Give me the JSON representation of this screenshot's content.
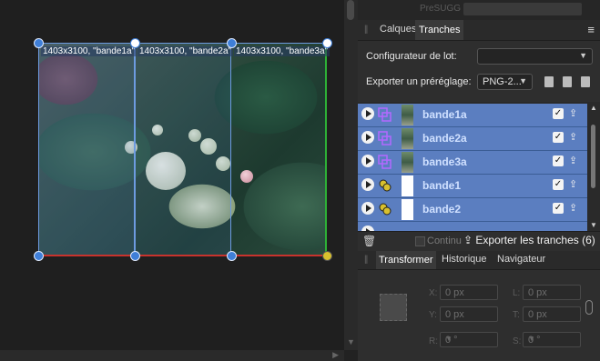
{
  "canvas": {
    "slices": [
      {
        "label": "1403x3100, \"bande1a\""
      },
      {
        "label": "1403x3100, \"bande2a\""
      },
      {
        "label": "1403x3100, \"bande3a\""
      }
    ]
  },
  "panel": {
    "top_ghost": "PreSUGG",
    "tabs": [
      {
        "label": "Calques"
      },
      {
        "label": "Tranches"
      }
    ],
    "active_tab": "Tranches",
    "batch_label": "Configurateur de lot:",
    "batch_value": "",
    "preset_label": "Exporter un préréglage:",
    "preset_value": "PNG-2...",
    "slices": [
      {
        "name": "bande1a",
        "checked": true
      },
      {
        "name": "bande2a",
        "checked": true
      },
      {
        "name": "bande3a",
        "checked": true
      },
      {
        "name": "bande1",
        "checked": true
      },
      {
        "name": "bande2",
        "checked": true
      }
    ],
    "continu_label": "Continu",
    "export_label": "Exporter les tranches (6)"
  },
  "bottom_panel": {
    "tabs": [
      {
        "label": "Transformer"
      },
      {
        "label": "Historique"
      },
      {
        "label": "Navigateur"
      }
    ],
    "active_tab": "Transformer",
    "fields": {
      "x_label": "X:",
      "x_value": "0 px",
      "y_label": "Y:",
      "y_value": "0 px",
      "l_label": "L:",
      "l_value": "0 px",
      "t_label": "T:",
      "t_value": "0 px",
      "r_label": "R:",
      "r_value": "0 °",
      "s_label": "S:",
      "s_value": "0 °"
    }
  },
  "colors": {
    "selection_blue": "#5b7ec0",
    "handle_blue": "#3f7fd8",
    "green_edge": "#2db036",
    "red_edge": "#c8332d"
  }
}
